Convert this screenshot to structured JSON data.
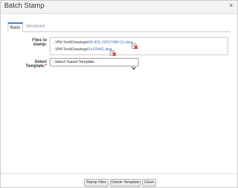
{
  "dialog": {
    "title": "Batch Stamp",
    "close_glyph": "×"
  },
  "tabs": [
    {
      "label": "Basic",
      "active": true
    },
    {
      "label": "Advanced",
      "active": false
    }
  ],
  "files": {
    "label": "Files to stamp:",
    "items": [
      {
        "path": "..\\PM Test\\Drawings\\",
        "name": "09-IDS-22017080 (1).dwg",
        "icon": "delete-file-icon"
      },
      {
        "path": "..\\PM Test\\Drawings\\",
        "name": "1x1DWG.dwg",
        "icon": "delete-file-icon"
      }
    ]
  },
  "template": {
    "label": "Select Template:",
    "required_mark": "*",
    "selected": "- Select Saved Template -"
  },
  "buttons": {
    "stamp": "Stamp Files",
    "delete_template": "Delete Template",
    "close": "Close"
  },
  "colors": {
    "accent": "#3a77c5",
    "link": "#3a6fb0",
    "required": "#c00000"
  }
}
